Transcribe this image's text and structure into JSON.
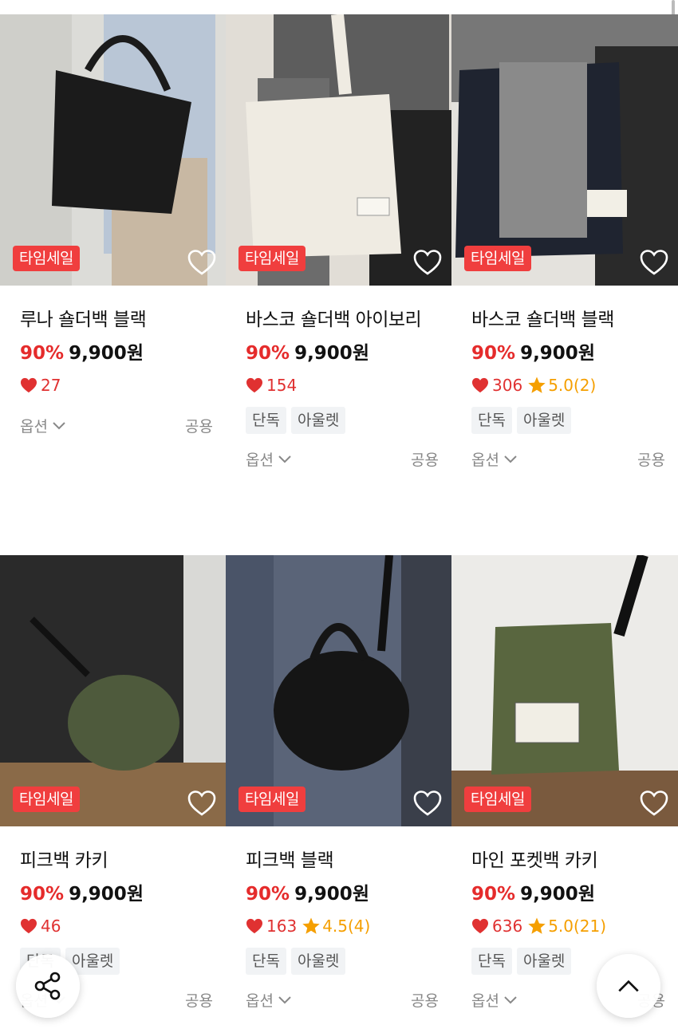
{
  "products": [
    {
      "title": "루나 숄더백 블랙",
      "badge": "타임세일",
      "discount": "90%",
      "price": "9,900원",
      "likes": "27",
      "rating": "",
      "tags": [],
      "option": "옵션",
      "gender": "공용",
      "bag_color": "#1b1b1b"
    },
    {
      "title": "바스코 숄더백 아이보리",
      "badge": "타임세일",
      "discount": "90%",
      "price": "9,900원",
      "likes": "154",
      "rating": "",
      "tags": [
        "단독",
        "아울렛"
      ],
      "option": "옵션",
      "gender": "공용",
      "bag_color": "#efebe2"
    },
    {
      "title": "바스코 숄더백 블랙",
      "badge": "타임세일",
      "discount": "90%",
      "price": "9,900원",
      "likes": "306",
      "rating": "5.0(2)",
      "tags": [
        "단독",
        "아울렛"
      ],
      "option": "옵션",
      "gender": "공용",
      "bag_color": "#1f2430"
    },
    {
      "title": "피크백 카키",
      "badge": "타임세일",
      "discount": "90%",
      "price": "9,900원",
      "likes": "46",
      "rating": "",
      "tags": [
        "단독",
        "아울렛"
      ],
      "option": "옵션",
      "gender": "공용",
      "bag_color": "#4e5a3c"
    },
    {
      "title": "피크백 블랙",
      "badge": "타임세일",
      "discount": "90%",
      "price": "9,900원",
      "likes": "163",
      "rating": "4.5(4)",
      "tags": [
        "단독",
        "아울렛"
      ],
      "option": "옵션",
      "gender": "공용",
      "bag_color": "#151515"
    },
    {
      "title": "마인 포켓백 카키",
      "badge": "타임세일",
      "discount": "90%",
      "price": "9,900원",
      "likes": "636",
      "rating": "5.0(21)",
      "tags": [
        "단독",
        "아울렛"
      ],
      "option": "옵션",
      "gender": "공용",
      "bag_color": "#59663f"
    }
  ],
  "icons": {
    "heart": "heart-icon",
    "star": "star-icon",
    "share": "share-icon",
    "top": "chevron-up-icon",
    "chevron": "chevron-down-icon"
  },
  "colors": {
    "accent_red": "#e52b2b",
    "badge_red": "#f03e3e",
    "star": "#f59f00"
  }
}
